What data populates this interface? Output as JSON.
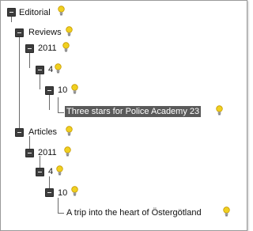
{
  "tree": {
    "editorial": {
      "label": "Editorial",
      "icon": "lightbulb-icon"
    },
    "reviews": {
      "label": "Reviews",
      "year": "2011",
      "month": "4",
      "day": "10",
      "item": "Three stars for Police Academy 23"
    },
    "articles": {
      "label": "Articles",
      "year": "2011",
      "month": "4",
      "day": "10",
      "item": "A trip into the heart of Östergötland"
    }
  },
  "colors": {
    "selection": "#5a5a5a",
    "toggle": "#3d3d3d",
    "bulb": "#f0d020"
  }
}
